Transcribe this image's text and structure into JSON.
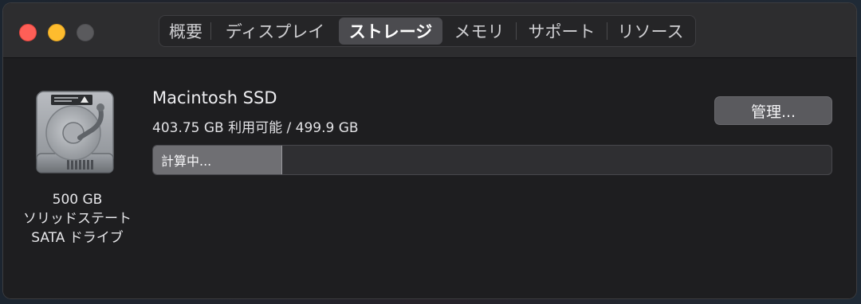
{
  "tabs": [
    {
      "label": "概要",
      "active": false
    },
    {
      "label": "ディスプレイ",
      "active": false
    },
    {
      "label": "ストレージ",
      "active": true
    },
    {
      "label": "メモリ",
      "active": false
    },
    {
      "label": "サポート",
      "active": false
    },
    {
      "label": "リソース",
      "active": false
    }
  ],
  "drive": {
    "icon": "hard-drive-icon",
    "caption_line1": "500 GB",
    "caption_line2": "ソリッドステート",
    "caption_line3": "SATA ドライブ"
  },
  "volume": {
    "name": "Macintosh SSD",
    "capacity": "403.75 GB 利用可能 / 499.9 GB",
    "manage_button": "管理...",
    "bar_label": "計算中...",
    "bar_fill_fraction": 0.19
  },
  "colors": {
    "close": "#fe5f57",
    "minimize": "#febc2e",
    "zoom_disabled": "#5a5a5d",
    "window_bg": "#1e1e20",
    "titlebar_bg": "#2d2d2f"
  }
}
